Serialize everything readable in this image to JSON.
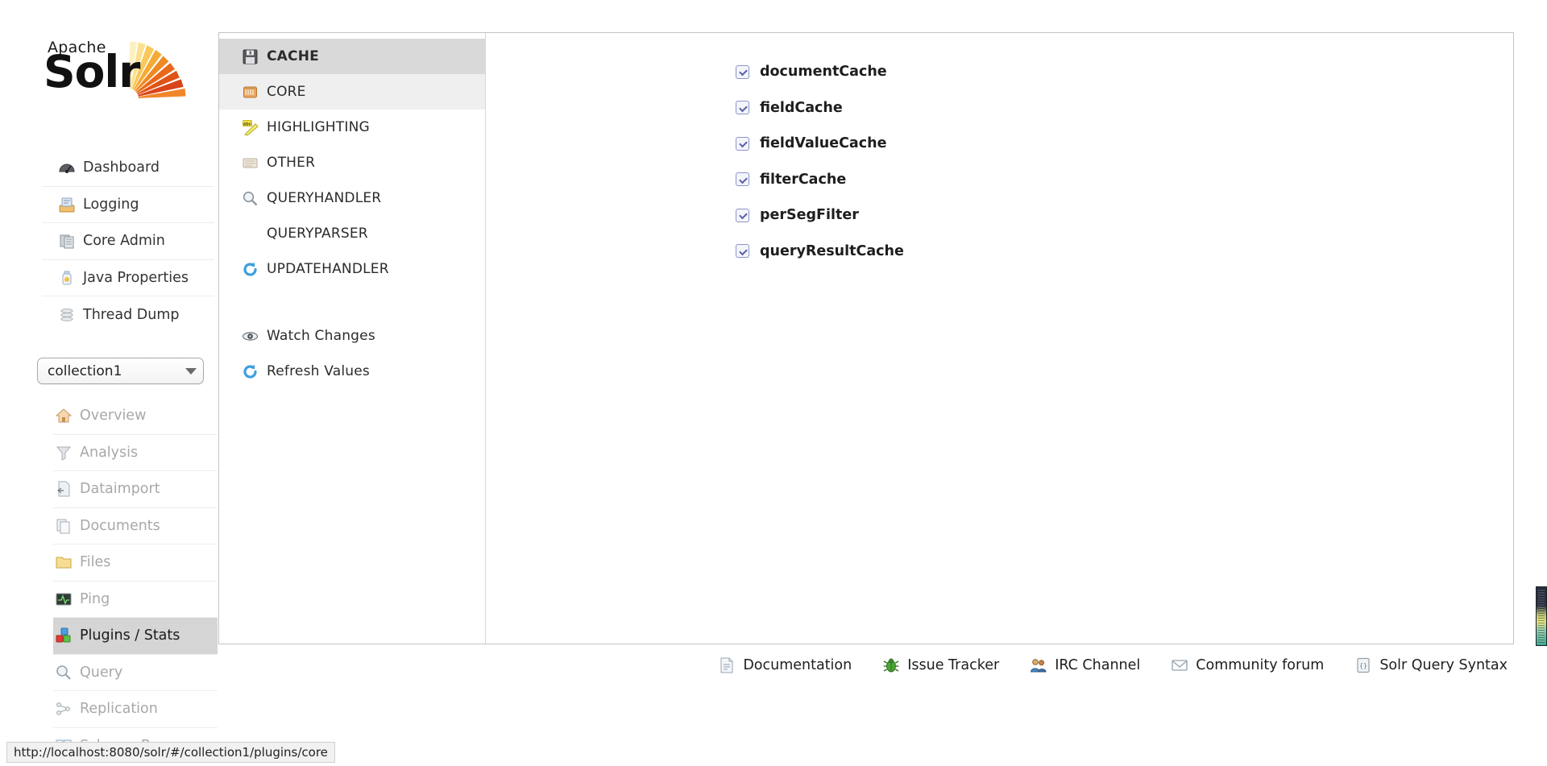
{
  "logo": {
    "top_word": "Apache",
    "main_word": "Solr"
  },
  "sidebar": {
    "main_items": [
      {
        "label": "Dashboard",
        "icon": "dashboard-icon",
        "state": "enabled"
      },
      {
        "label": "Logging",
        "icon": "logging-icon",
        "state": "enabled"
      },
      {
        "label": "Core Admin",
        "icon": "core-admin-icon",
        "state": "enabled"
      },
      {
        "label": "Java Properties",
        "icon": "java-properties-icon",
        "state": "enabled"
      },
      {
        "label": "Thread Dump",
        "icon": "thread-dump-icon",
        "state": "enabled"
      }
    ],
    "core_selector": {
      "value": "collection1",
      "caret": "chevron-down-icon"
    },
    "core_items": [
      {
        "label": "Overview",
        "icon": "home-icon",
        "state": "disabled"
      },
      {
        "label": "Analysis",
        "icon": "funnel-icon",
        "state": "disabled"
      },
      {
        "label": "Dataimport",
        "icon": "dataimport-icon",
        "state": "disabled"
      },
      {
        "label": "Documents",
        "icon": "documents-icon",
        "state": "disabled"
      },
      {
        "label": "Files",
        "icon": "folder-icon",
        "state": "disabled"
      },
      {
        "label": "Ping",
        "icon": "ping-icon",
        "state": "disabled"
      },
      {
        "label": "Plugins / Stats",
        "icon": "plugins-icon",
        "state": "active"
      },
      {
        "label": "Query",
        "icon": "magnifier-icon",
        "state": "disabled"
      },
      {
        "label": "Replication",
        "icon": "replication-icon",
        "state": "disabled"
      },
      {
        "label": "Schema Browser",
        "icon": "book-icon",
        "state": "disabled"
      }
    ]
  },
  "plugin_menu": {
    "types": [
      {
        "label": "CACHE",
        "icon": "floppy-disk-icon",
        "state": "selected"
      },
      {
        "label": "CORE",
        "icon": "core-box-icon",
        "state": "hovered"
      },
      {
        "label": "HIGHLIGHTING",
        "icon": "highlighter-icon",
        "state": "normal"
      },
      {
        "label": "OTHER",
        "icon": "other-icon",
        "state": "normal"
      },
      {
        "label": "QUERYHANDLER",
        "icon": "magnifier-icon",
        "state": "normal"
      },
      {
        "label": "QUERYPARSER",
        "icon": "none",
        "state": "normal"
      },
      {
        "label": "UPDATEHANDLER",
        "icon": "refresh-icon",
        "state": "normal"
      }
    ],
    "actions": [
      {
        "label": "Watch Changes",
        "icon": "eye-icon"
      },
      {
        "label": "Refresh Values",
        "icon": "refresh-icon"
      }
    ]
  },
  "plugin_content": {
    "entries": [
      {
        "name": "documentCache",
        "toggle": "expand-toggle-icon"
      },
      {
        "name": "fieldCache",
        "toggle": "expand-toggle-icon"
      },
      {
        "name": "fieldValueCache",
        "toggle": "expand-toggle-icon"
      },
      {
        "name": "filterCache",
        "toggle": "expand-toggle-icon"
      },
      {
        "name": "perSegFilter",
        "toggle": "expand-toggle-icon"
      },
      {
        "name": "queryResultCache",
        "toggle": "expand-toggle-icon"
      }
    ]
  },
  "footer": {
    "links": [
      {
        "label": "Documentation",
        "icon": "document-icon"
      },
      {
        "label": "Issue Tracker",
        "icon": "bug-icon"
      },
      {
        "label": "IRC Channel",
        "icon": "people-icon"
      },
      {
        "label": "Community forum",
        "icon": "envelope-icon"
      },
      {
        "label": "Solr Query Syntax",
        "icon": "code-icon"
      }
    ]
  },
  "status_bar": {
    "url": "http://localhost:8080/solr/#/collection1/plugins/core"
  },
  "colors": {
    "accent_orange": "#d9541e",
    "selected_grey": "#d5d5d5",
    "panel_border": "#c4c4c4",
    "toggle_blue": "#5760a8"
  }
}
